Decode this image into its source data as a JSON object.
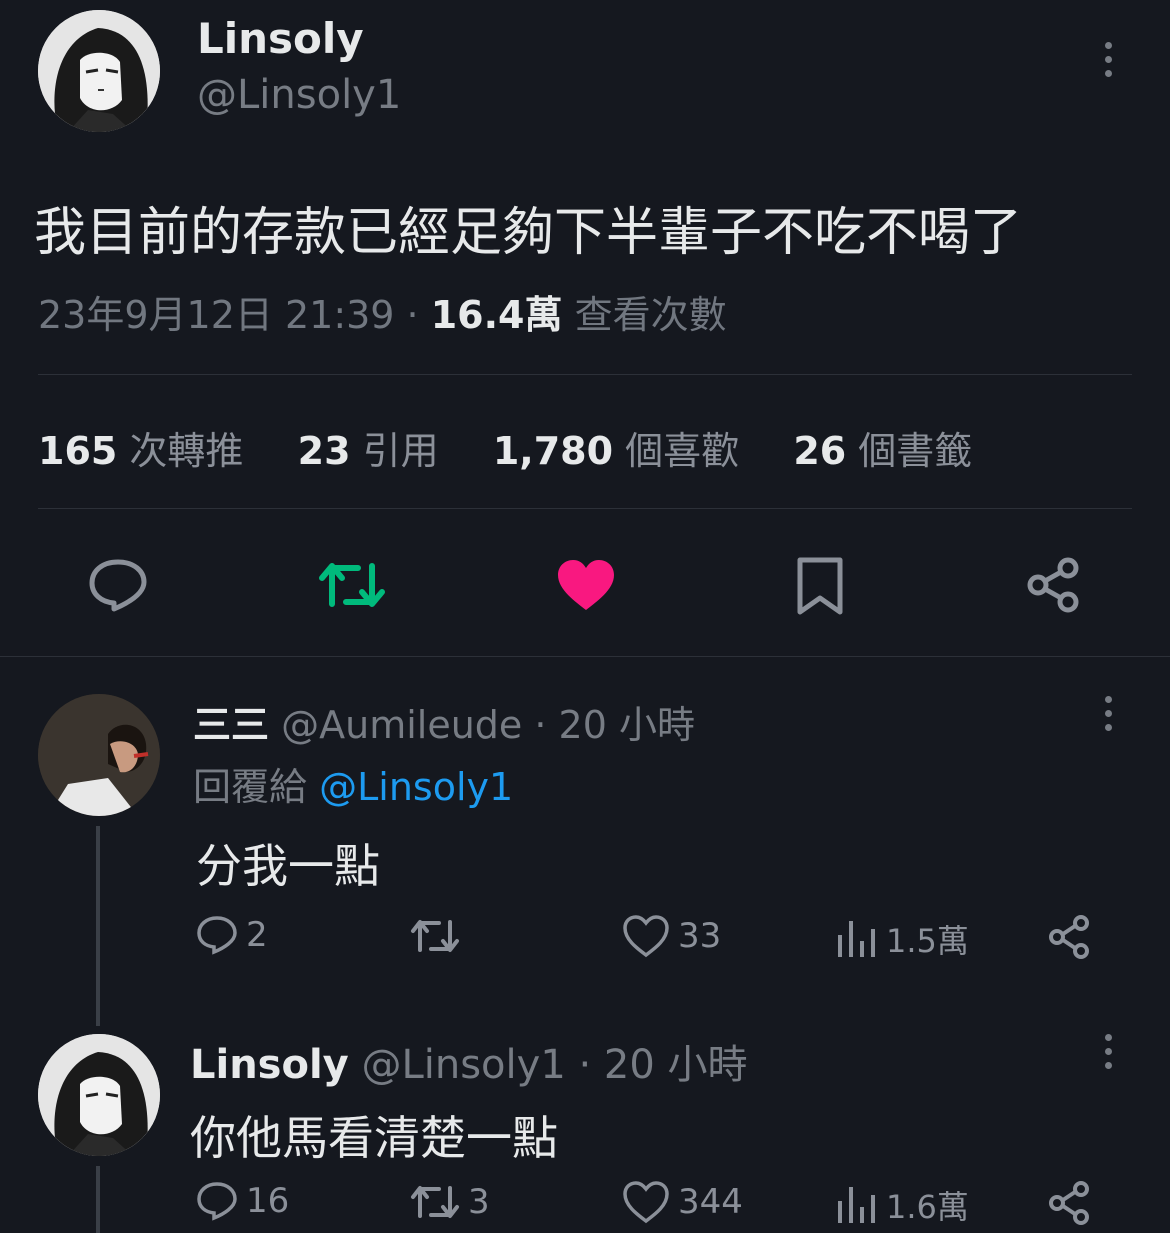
{
  "main_tweet": {
    "display_name": "Linsoly",
    "handle": "@Linsoly1",
    "text": "我目前的存款已經足夠下半輩子不吃不喝了",
    "date": "23年9月12日 21:39 · ",
    "views": "16.4萬",
    "views_label": " 查看次數",
    "stats": {
      "retweets": "165",
      "retweets_label": "次轉推",
      "quotes": "23",
      "quotes_label": "引用",
      "likes": "1,780",
      "likes_label": "個喜歡",
      "bookmarks": "26",
      "bookmarks_label": "個書籤"
    },
    "icons": [
      "reply-icon",
      "retweet-icon",
      "heart-icon",
      "bookmark-icon",
      "share-icon"
    ],
    "colors": {
      "retweet": "#00ba7c",
      "like": "#f91880"
    }
  },
  "replies": [
    {
      "display_name": "三三",
      "handle": "@Aumileude",
      "time": " · 20 小時",
      "reply_to_label": "回覆給 ",
      "reply_to_handle": "@Linsoly1",
      "text": "分我一點",
      "reply_count": "2",
      "retweet_count": "",
      "like_count": "33",
      "view_count": "1.5萬"
    },
    {
      "display_name": "Linsoly",
      "handle": "@Linsoly1",
      "time": " · 20 小時",
      "text": "你他馬看清楚一點",
      "reply_count": "16",
      "retweet_count": "3",
      "like_count": "344",
      "view_count": "1.6萬"
    }
  ]
}
